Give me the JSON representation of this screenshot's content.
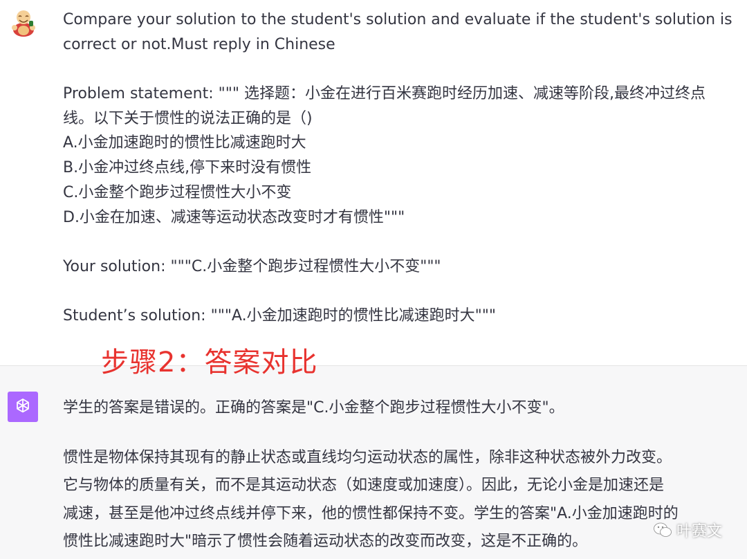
{
  "user_message": {
    "lines": [
      "Compare your solution to the student's solution and evaluate if the student's solution is",
      "correct or not.Must reply in Chinese",
      "",
      "Problem statement: \"\"\" 选择题：小金在进行百米赛跑时经历加速、减速等阶段,最终冲过终点",
      "线。以下关于惯性的说法正确的是（)",
      "A.小金加速跑时的惯性比减速跑时大",
      "B.小金冲过终点线,停下来时没有惯性",
      "C.小金整个跑步过程惯性大小不变",
      "D.小金在加速、减速等运动状态改变时才有惯性\"\"\"",
      "",
      "Your solution: \"\"\"C.小金整个跑步过程惯性大小不变\"\"\"",
      "",
      "Student’s solution: \"\"\"A.小金加速跑时的惯性比减速跑时大\"\"\""
    ]
  },
  "annotation": {
    "step_label": "步骤2：答案对比",
    "color": "#e8332f"
  },
  "assistant_message": {
    "summary": "学生的答案是错误的。正确的答案是\"C.小金整个跑步过程惯性大小不变\"。",
    "paragraph_lines": [
      "惯性是物体保持其现有的静止状态或直线均匀运动状态的属性，除非这种状态被外力改变。",
      "它与物体的质量有关，而不是其运动状态（如速度或加速度）。因此，无论小金是加速还是",
      "减速，甚至是他冲过终点线并停下来，他的惯性都保持不变。学生的答案\"A.小金加速跑时的",
      "惯性比减速跑时大\"暗示了惯性会随着运动状态的改变而改变，这是不正确的。"
    ]
  },
  "watermark": {
    "text": "叶赛文",
    "icon": "wechat-icon"
  },
  "colors": {
    "assistant_bg": "#f7f7f8",
    "ai_avatar_bg": "#ab68ff",
    "text": "#343541"
  }
}
